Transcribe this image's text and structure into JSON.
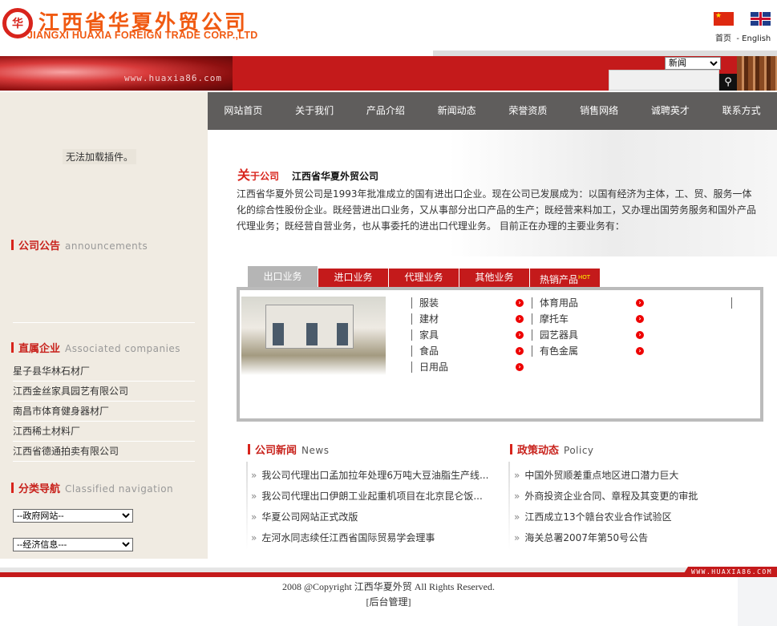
{
  "header": {
    "logo_mark": "华",
    "logo_cn": "江西省华夏外贸公司",
    "logo_en": "JIANGXI HUAXIA FOREIGN TRADE CORP.,LTD",
    "lang_home": "首页",
    "lang_sep": "-",
    "lang_en": "English"
  },
  "banner": {
    "url": "www.huaxia86.com",
    "search_select": "新闻",
    "search_value": "",
    "search_icon": "magnifier-icon"
  },
  "nav": [
    "网站首页",
    "关于我们",
    "产品介绍",
    "新闻动态",
    "荣誉资质",
    "销售网络",
    "诚聘英才",
    "联系方式"
  ],
  "sidebar": {
    "plugin_msg": "无法加载插件。",
    "announcements": {
      "cn": "公司公告",
      "en": "announcements"
    },
    "companies": {
      "cn": "直属企业",
      "en": "Associated companies",
      "items": [
        "星子县华林石材厂",
        "江西金丝家具园艺有限公司",
        "南昌市体育健身器材厂",
        "江西稀土材料厂",
        "江西省德通拍卖有限公司"
      ]
    },
    "classified": {
      "cn": "分类导航",
      "en": "Classified navigation",
      "select1": "--政府网站--",
      "select2": "--经济信息---"
    }
  },
  "about": {
    "title_big": "关",
    "title_small": "于公司",
    "company": "江西省华夏外贸公司",
    "text": "江西省华夏外贸公司是1993年批准成立的国有进出口企业。现在公司已发展成为：以国有经济为主体，工、贸、服务一体化的综合性股份企业。既经营进出口业务，又从事部分出口产品的生产；既经营来料加工，又办理出国劳务服务和国外产品代理业务；既经营自营业务，也从事委托的进出口代理业务。 目前正在办理的主要业务有："
  },
  "tabs": [
    {
      "label": "出口业务"
    },
    {
      "label": "进口业务"
    },
    {
      "label": "代理业务"
    },
    {
      "label": "其他业务"
    },
    {
      "label": "热销产品",
      "badge": "HOT"
    }
  ],
  "products": {
    "col1": [
      "服装",
      "建材",
      "家具",
      "食品",
      "日用品"
    ],
    "col2": [
      "体育用品",
      "摩托车",
      "园艺器具",
      "有色金属"
    ]
  },
  "news": {
    "cn": "公司新闻",
    "en": "News",
    "items": [
      "我公司代理出口孟加拉年处理6万吨大豆油脂生产线...",
      "我公司代理出口伊朗工业起重机项目在北京昆仑饭...",
      "华夏公司网站正式改版",
      "左河水同志续任江西省国际贸易学会理事"
    ]
  },
  "policy": {
    "cn": "政策动态",
    "en": "Policy",
    "items": [
      "中国外贸顺差重点地区进口潜力巨大",
      "外商投资企业合同、章程及其变更的审批",
      "江西成立13个赣台农业合作试验区",
      "海关总署2007年第50号公告"
    ]
  },
  "footer": {
    "badge": "WWW.HUAXIA86.COM",
    "copyright": "2008 @Copyright 江西华夏外贸 All Rights Reserved.",
    "admin": "[后台管理]"
  },
  "colors": {
    "brand_red": "#c41a1b",
    "nav_bg": "#5f5d5c",
    "sidebar_bg": "#f0ebe2",
    "logo_orange": "#f05a12"
  }
}
